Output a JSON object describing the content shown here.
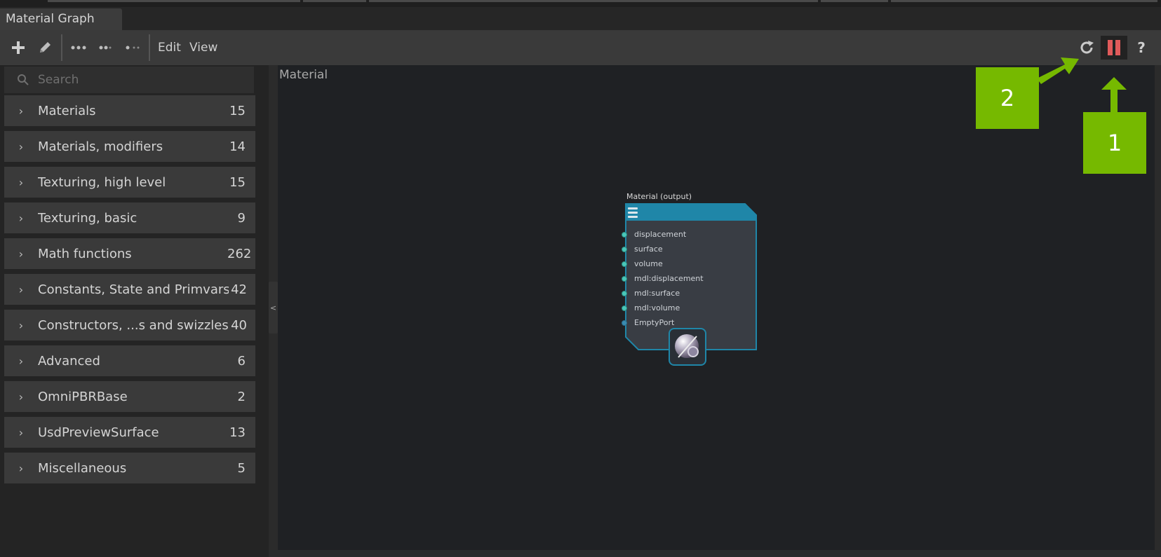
{
  "window": {
    "tab_title": "Material Graph"
  },
  "toolbar": {
    "add_icon": "plus-icon",
    "edit_icon": "pencil-icon",
    "layout_icons": [
      "dots-horizontal-icon",
      "dots-compact-icon",
      "dots-collapsed-icon"
    ],
    "menu_edit": "Edit",
    "menu_view": "View",
    "refresh_icon": "refresh-icon",
    "pause_icon": "pause-icon",
    "help_label": "?"
  },
  "sidebar": {
    "search_placeholder": "Search",
    "categories": [
      {
        "label": "Materials",
        "count": "15"
      },
      {
        "label": "Materials, modifiers",
        "count": "14"
      },
      {
        "label": "Texturing, high level",
        "count": "15"
      },
      {
        "label": "Texturing, basic",
        "count": "9"
      },
      {
        "label": "Math functions",
        "count": "262"
      },
      {
        "label": "Constants, State and Primvars",
        "count": "42"
      },
      {
        "label": "Constructors, ...s and swizzles",
        "count": "40"
      },
      {
        "label": "Advanced",
        "count": "6"
      },
      {
        "label": "OmniPBRBase",
        "count": "2"
      },
      {
        "label": "UsdPreviewSurface",
        "count": "13"
      },
      {
        "label": "Miscellaneous",
        "count": "5"
      }
    ],
    "collapse_label": "<"
  },
  "graph": {
    "title": "Material",
    "node": {
      "title": "Material (output)",
      "ports": [
        "displacement",
        "surface",
        "volume",
        "mdl:displacement",
        "mdl:surface",
        "mdl:volume",
        "EmptyPort"
      ]
    }
  },
  "annotations": {
    "badge_1": "1",
    "badge_2": "2"
  },
  "colors": {
    "accent_green": "#76b900",
    "pause_red": "#e05a5a",
    "node_header": "#1f86a8"
  }
}
